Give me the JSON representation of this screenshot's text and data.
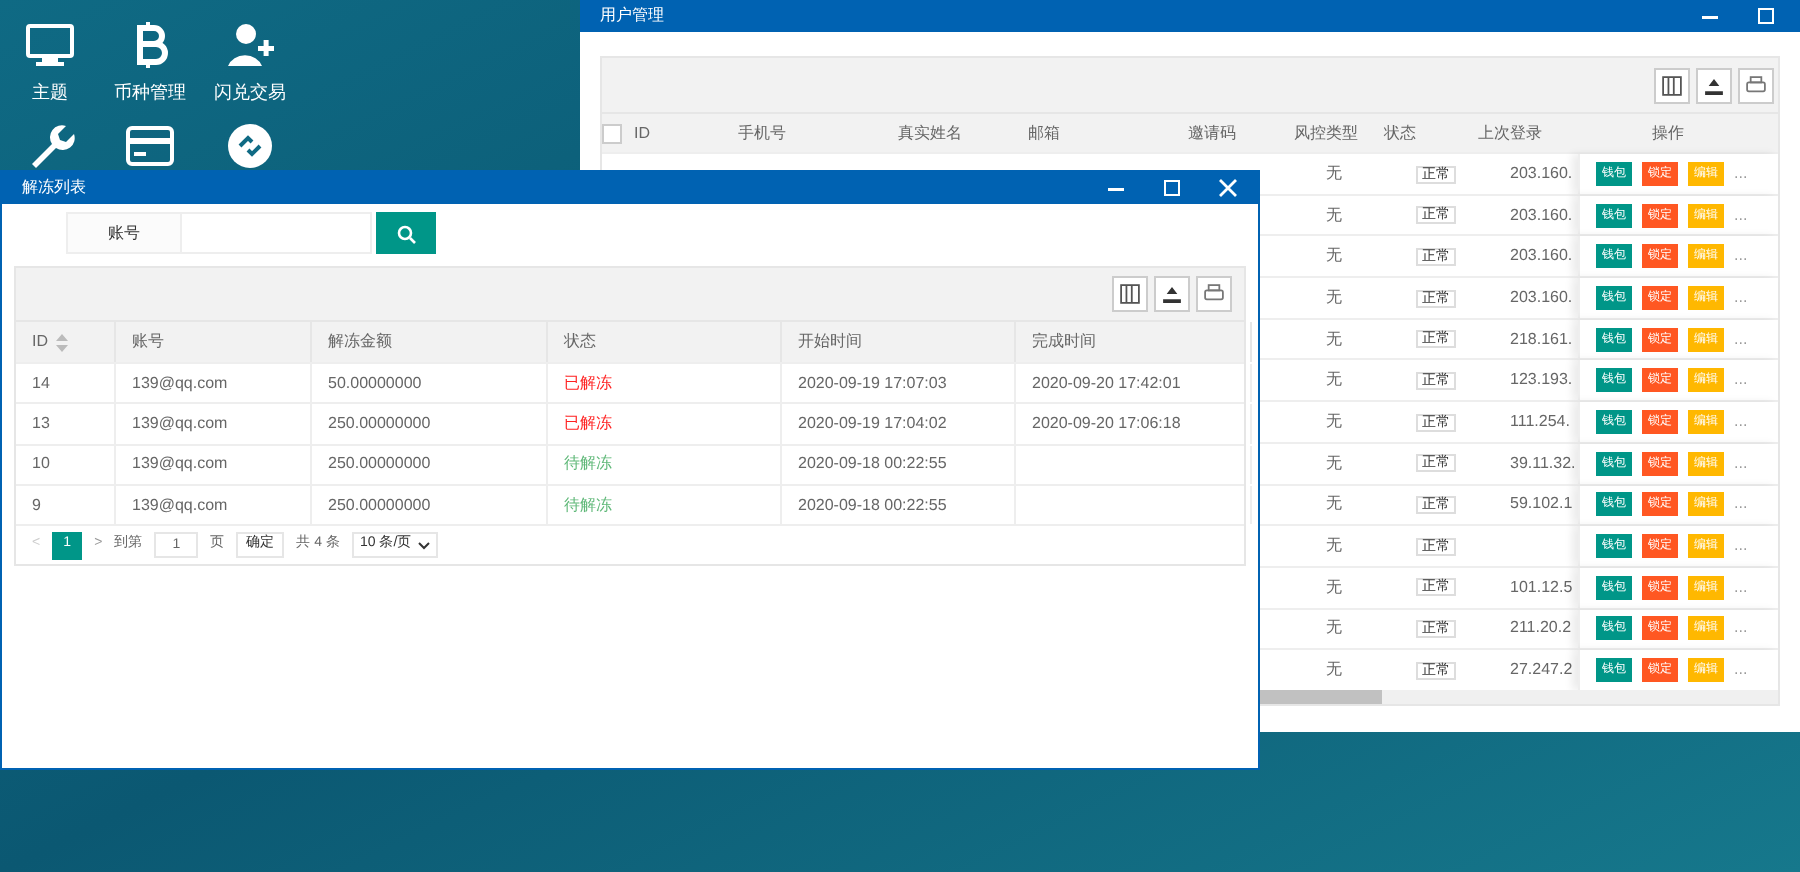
{
  "desktop_icons": [
    {
      "kind": "monitor",
      "label": "主题"
    },
    {
      "kind": "bitcoin",
      "label": "币种管理"
    },
    {
      "kind": "user-plus",
      "label": "闪兑交易"
    },
    {
      "kind": "wrench"
    },
    {
      "kind": "card"
    },
    {
      "kind": "link"
    }
  ],
  "user_window": {
    "title": "用户管理",
    "columns": [
      "ID",
      "手机号",
      "真实姓名",
      "邮箱",
      "邀请码",
      "风控类型",
      "状态",
      "上次登录",
      "操作"
    ],
    "select_all_checked": false,
    "rows": [
      {
        "risk": "无",
        "status": "正常",
        "last_login": "203.160.",
        "actions": [
          "钱包",
          "锁定",
          "编辑",
          "..."
        ]
      },
      {
        "risk": "无",
        "status": "正常",
        "last_login": "203.160.",
        "actions": [
          "钱包",
          "锁定",
          "编辑",
          "..."
        ]
      },
      {
        "risk": "无",
        "status": "正常",
        "last_login": "203.160.",
        "actions": [
          "钱包",
          "锁定",
          "编辑",
          "..."
        ]
      },
      {
        "risk": "无",
        "status": "正常",
        "last_login": "203.160.",
        "actions": [
          "钱包",
          "锁定",
          "编辑",
          "..."
        ]
      },
      {
        "risk": "无",
        "status": "正常",
        "last_login": "218.161.",
        "actions": [
          "钱包",
          "锁定",
          "编辑",
          "..."
        ]
      },
      {
        "risk": "无",
        "status": "正常",
        "last_login": "123.193.",
        "actions": [
          "钱包",
          "锁定",
          "编辑",
          "..."
        ]
      },
      {
        "risk": "无",
        "status": "正常",
        "last_login": "111.254.",
        "actions": [
          "钱包",
          "锁定",
          "编辑",
          "..."
        ]
      },
      {
        "risk": "无",
        "status": "正常",
        "last_login": "39.11.32.",
        "actions": [
          "钱包",
          "锁定",
          "编辑",
          "..."
        ]
      },
      {
        "risk": "无",
        "status": "正常",
        "last_login": "59.102.1",
        "actions": [
          "钱包",
          "锁定",
          "编辑",
          "..."
        ]
      },
      {
        "risk": "无",
        "status": "正常",
        "actions": [
          "钱包",
          "锁定",
          "编辑",
          "..."
        ]
      },
      {
        "risk": "无",
        "status": "正常",
        "last_login": "101.12.5",
        "actions": [
          "钱包",
          "锁定",
          "编辑",
          "..."
        ]
      },
      {
        "risk": "无",
        "status": "正常",
        "last_login": "211.20.2",
        "actions": [
          "钱包",
          "锁定",
          "编辑",
          "..."
        ]
      },
      {
        "risk": "无",
        "status": "正常",
        "last_login": "27.247.2",
        "actions": [
          "钱包",
          "锁定",
          "编辑",
          "..."
        ]
      }
    ]
  },
  "unfreeze_window": {
    "title": "解冻列表",
    "search": {
      "label": "账号"
    },
    "columns": [
      "ID",
      "账号",
      "解冻金额",
      "状态",
      "开始时间",
      "完成时间"
    ],
    "rows": [
      {
        "id": "14",
        "account": "139@qq.com",
        "amount": "50.00000000",
        "status": "已解冻",
        "color": "#ff2222",
        "start": "2020-09-19 17:07:03",
        "end": "2020-09-20 17:42:01"
      },
      {
        "id": "13",
        "account": "139@qq.com",
        "amount": "250.00000000",
        "status": "已解冻",
        "color": "#ff2222",
        "start": "2020-09-19 17:04:02",
        "end": "2020-09-20 17:06:18"
      },
      {
        "id": "10",
        "account": "139@qq.com",
        "amount": "250.00000000",
        "status": "待解冻",
        "color": "#5fb878",
        "start": "2020-09-18 00:22:55"
      },
      {
        "id": "9",
        "account": "139@qq.com",
        "amount": "250.00000000",
        "status": "待解冻",
        "color": "#5fb878",
        "start": "2020-09-18 00:22:55"
      }
    ],
    "pagination": {
      "prev": "<",
      "pages": [
        {
          "label": "1",
          "selected": true
        }
      ],
      "next": ">",
      "goto": "到第",
      "page_value": "1",
      "page_unit": "页",
      "confirm": "确定",
      "total": "共 4 条",
      "page_size": "10 条/页"
    }
  }
}
